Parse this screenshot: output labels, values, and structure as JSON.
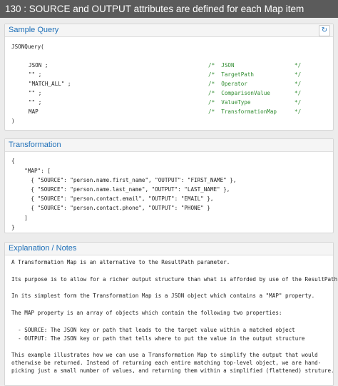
{
  "title": "130 :  SOURCE and OUTPUT attributes are defined for each Map item",
  "sample": {
    "heading": "Sample Query",
    "refresh_icon": "↻",
    "open_line": "JSONQuery(",
    "rows": [
      {
        "arg": "JSON ;",
        "cmt": "/*  JSON",
        "end": "*/"
      },
      {
        "arg": "\"\" ;",
        "cmt": "/*  TargetPath",
        "end": "*/"
      },
      {
        "arg": "\"MATCH_ALL\" ;",
        "cmt": "/*  Operator",
        "end": "*/"
      },
      {
        "arg": "\"\" ;",
        "cmt": "/*  ComparisonValue",
        "end": "*/"
      },
      {
        "arg": "\"\" ;",
        "cmt": "/*  ValueType",
        "end": "*/"
      },
      {
        "arg": "MAP",
        "cmt": "/*  TransformationMap",
        "end": "*/"
      }
    ],
    "close_line": ")"
  },
  "transform": {
    "heading": "Transformation",
    "lines": [
      "{",
      "    \"MAP\": [",
      "      { \"SOURCE\": \"person.name.first_name\", \"OUTPUT\": \"FIRST_NAME\" },",
      "      { \"SOURCE\": \"person.name.last_name\", \"OUTPUT\": \"LAST_NAME\" },",
      "      { \"SOURCE\": \"person.contact.email\", \"OUTPUT\": \"EMAIL\" },",
      "      { \"SOURCE\": \"person.contact.phone\", \"OUTPUT\": \"PHONE\" }",
      "    ]",
      "}"
    ]
  },
  "notes": {
    "heading": "Explanation / Notes",
    "p1": "A Transformation Map is an alternative to the ResultPath parameter.",
    "p2": "Its purpose is to allow for a richer output structure than what is afforded by use of the ResultPath.",
    "p3": "In its simplest form the Transformation Map is a JSON object which contains a \"MAP\" property.",
    "p4": "The MAP property is an array of objects which contain the following two properties:",
    "b1": "  - SOURCE: The JSON key or path that leads to the target value within a matched object",
    "b2": "  - OUTPUT: The JSON key or path that tells where to put the value in the output structure",
    "p5a": "This example illustrates how we can use a Transformation Map to simplify the output that would",
    "p5b": "otherwise be returned. Instead of returning each entire matching top-level object, we are hand-",
    "p5c": "picking just a small number of values, and returning them within a simplified (flattened) struture."
  }
}
